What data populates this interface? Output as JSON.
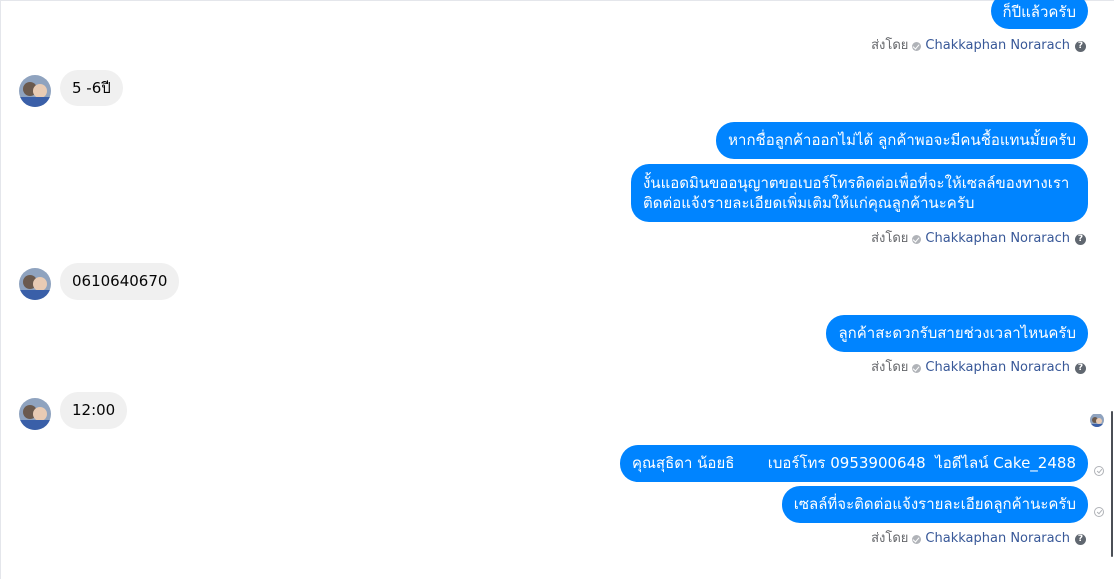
{
  "messages": {
    "out_1": "ก็ปีแล้วครับ",
    "in_1": "5  -6ปี",
    "out_2": "หากชื่อลูกค้าออกไม่ได้ ลูกค้าพอจะมีคนชื้อแทนมั้ยครับ",
    "out_3": "งั้นแอดมินขออนุญาตขอเบอร์โทรติดต่อเพื่อที่จะให้เซลล์ของทางเราติดต่อแจ้งรายละเอียดเพิ่มเติมให้แก่คุณลูกค้านะครับ",
    "in_2": "0610640670",
    "out_4": "ลูกค้าสะดวกรับสายช่วงเวลาไหนครับ",
    "in_3": "12:00",
    "out_5": "คุณสุธิดา น้อยธิ       เบอร์โทร 0953900648  ไอดีไลน์ Cake_2488",
    "out_6": "เซลล์ที่จะติดต่อแจ้งรายละเอียดลูกค้านะครับ"
  },
  "sent_by": {
    "label": "ส่งโดย",
    "name": "Chakkaphan Norarach",
    "help": "?"
  },
  "colors": {
    "outgoing_bubble": "#0084ff",
    "incoming_bubble": "#f0f0f0",
    "sender_name": "#385898"
  }
}
